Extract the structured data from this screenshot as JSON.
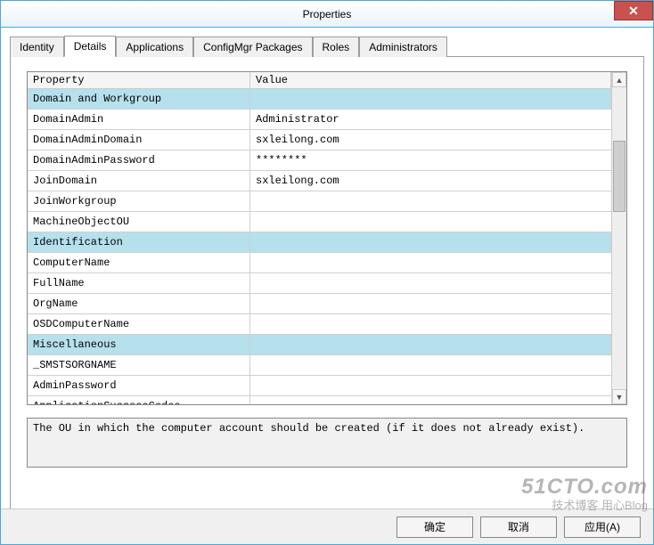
{
  "window": {
    "title": "Properties",
    "close_glyph": "✕"
  },
  "tabs": [
    {
      "label": "Identity"
    },
    {
      "label": "Details"
    },
    {
      "label": "Applications"
    },
    {
      "label": "ConfigMgr Packages"
    },
    {
      "label": "Roles"
    },
    {
      "label": "Administrators"
    }
  ],
  "grid": {
    "header_property": "Property",
    "header_value": "Value",
    "rows": [
      {
        "type": "group",
        "property": "Domain and Workgroup",
        "value": ""
      },
      {
        "type": "item",
        "property": "DomainAdmin",
        "value": "Administrator"
      },
      {
        "type": "item",
        "property": "DomainAdminDomain",
        "value": "sxleilong.com"
      },
      {
        "type": "item",
        "property": "DomainAdminPassword",
        "value": "********"
      },
      {
        "type": "item",
        "property": "JoinDomain",
        "value": "sxleilong.com"
      },
      {
        "type": "item",
        "property": "JoinWorkgroup",
        "value": ""
      },
      {
        "type": "item",
        "property": "MachineObjectOU",
        "value": ""
      },
      {
        "type": "group",
        "property": "Identification",
        "value": ""
      },
      {
        "type": "item",
        "property": "ComputerName",
        "value": ""
      },
      {
        "type": "item",
        "property": "FullName",
        "value": ""
      },
      {
        "type": "item",
        "property": "OrgName",
        "value": ""
      },
      {
        "type": "item",
        "property": "OSDComputerName",
        "value": ""
      },
      {
        "type": "group",
        "property": "Miscellaneous",
        "value": ""
      },
      {
        "type": "item",
        "property": "_SMSTSORGNAME",
        "value": ""
      },
      {
        "type": "item",
        "property": "AdminPassword",
        "value": ""
      },
      {
        "type": "item",
        "property": "ApplicationSuccessCodes",
        "value": ""
      }
    ]
  },
  "description": "The OU in which the computer account should be created (if it does not already exist).",
  "buttons": {
    "ok": "确定",
    "cancel": "取消",
    "apply": "应用(A)"
  },
  "watermark": {
    "line1": "51CTO.com",
    "line2": "技术博客  用心Blog"
  }
}
